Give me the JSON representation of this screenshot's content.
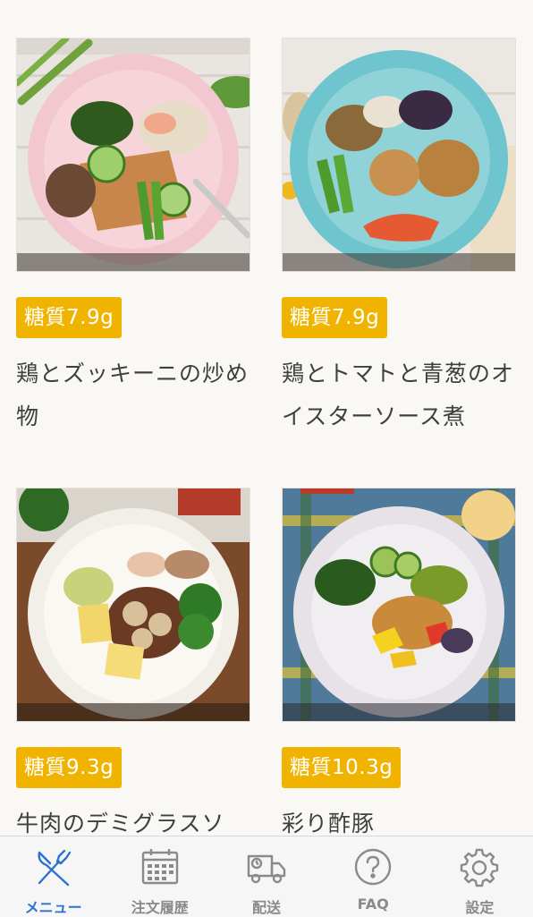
{
  "accent_color": "#2c72cf",
  "badge_color": "#f0b400",
  "products": [
    {
      "badge": "糖質7.9g",
      "title": "鶏とズッキーニの炒め物",
      "image": "pink-plate-chicken-zucchini"
    },
    {
      "badge": "糖質7.9g",
      "title": "鶏とトマトと青葱のオイスターソース煮",
      "image": "blue-plate-chicken-tomato"
    },
    {
      "badge": "糖質9.3g",
      "title": "牛肉のデミグラスソ",
      "image": "white-plate-hamburg"
    },
    {
      "badge": "糖質10.3g",
      "title": "彩り酢豚",
      "image": "striped-plate-sweet-sour-pork"
    }
  ],
  "tabbar": {
    "tabs": [
      {
        "label": "メニュー",
        "icon": "fork-knife-icon",
        "active": true
      },
      {
        "label": "注文履歴",
        "icon": "calendar-icon",
        "active": false
      },
      {
        "label": "配送",
        "icon": "truck-icon",
        "active": false
      },
      {
        "label": "FAQ",
        "icon": "question-icon",
        "active": false
      },
      {
        "label": "設定",
        "icon": "gear-icon",
        "active": false
      }
    ]
  }
}
